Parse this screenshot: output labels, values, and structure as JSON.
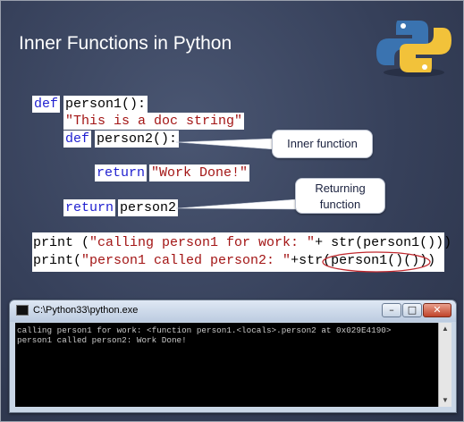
{
  "slide": {
    "title": "Inner Functions in Python",
    "logo_icon": "python-logo-icon"
  },
  "code": {
    "line1_kw": "def",
    "line1_name": "person1():",
    "line2": "\"This is a doc string\"",
    "line3_kw": "def",
    "line3_name": "person2():",
    "line4_kw": "return",
    "line4_str": "\"Work Done!\"",
    "line5_kw": "return",
    "line5_name": "person2"
  },
  "callouts": {
    "inner": "Inner function",
    "returning_line1": "Returning",
    "returning_line2": "function"
  },
  "prints": {
    "line1_a": "print (",
    "line1_str": "\"calling person1 for work: \"",
    "line1_b": "+ str(person1()))",
    "line2_a": "print(",
    "line2_str": "\"person1 called person2: \"",
    "line2_b": "+str(person1()()))"
  },
  "console": {
    "title": "C:\\Python33\\python.exe",
    "output_line1": "calling person1 for work: <function person1.<locals>.person2 at 0x029E4190>",
    "output_line2": "person1 called person2: Work Done!",
    "minimize": "–",
    "maximize": "□",
    "close": "✕"
  },
  "colors": {
    "keyword": "#1f1fd0",
    "string": "#a31515",
    "highlight_ellipse": "#c0282e"
  }
}
